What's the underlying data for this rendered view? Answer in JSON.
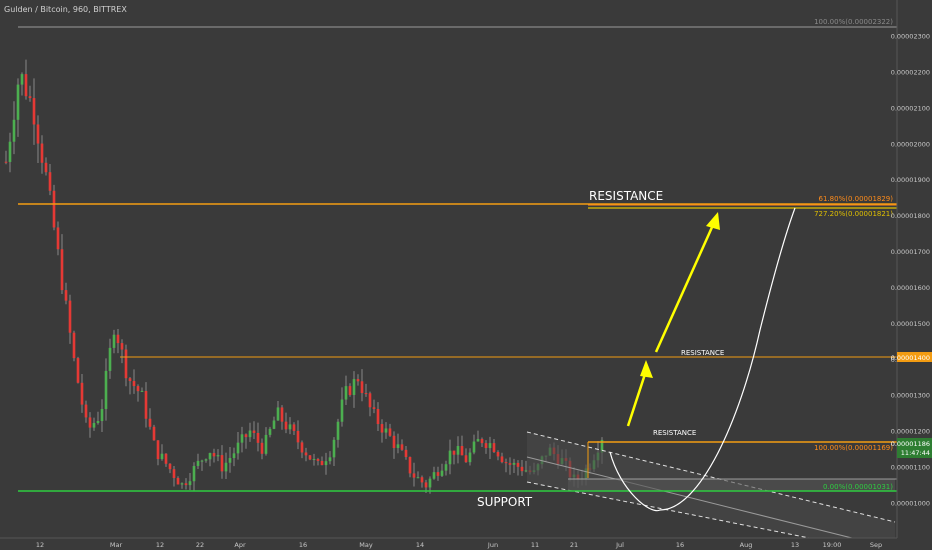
{
  "header": {
    "symbol_title": "Gulden / Bitcoin, 960, BITTREX"
  },
  "price_axis": {
    "ticks": [
      "0.00002300",
      "0.00002200",
      "0.00002100",
      "0.00002000",
      "0.00001900",
      "0.00001800",
      "0.00001700",
      "0.00001600",
      "0.00001500",
      "0.00001400",
      "0.00001300",
      "0.00001200",
      "0.00001100",
      "0.00001000"
    ],
    "current_price_label": "0.00001186",
    "countdown_label": "11:47:44",
    "level_1400_label": "0.00001400"
  },
  "time_axis": {
    "labels": [
      "12",
      "Mar",
      "12",
      "22",
      "Apr",
      "16",
      "May",
      "14",
      "Jun",
      "11",
      "21",
      "Jul",
      "16",
      "Aug",
      "13",
      "19:00",
      "Sep"
    ]
  },
  "annotations": {
    "resistance_top": "RESISTANCE",
    "resistance_mid": "RESISTANCE",
    "resistance_low": "RESISTANCE",
    "support": "SUPPORT",
    "fib_100_top": "100.00%(0.00002322)",
    "fib_61_8": "61.80%(0.00001829)",
    "fib_727_2": "727.20%(0.00001821)",
    "fib_100_low": "100.00%(0.00001169)",
    "fib_0": "0.00%(0.00001031)"
  },
  "colors": {
    "background": "#3a3a3a",
    "candle_up": "#4caf50",
    "candle_down": "#e53935",
    "support_line": "#2ecc40",
    "resistance_line": "#f39c12",
    "arrow": "#ffff00",
    "fib_text": "#ff8c1a"
  },
  "chart_data": {
    "type": "candlestick",
    "title": "Gulden / Bitcoin, 960, BITTREX",
    "ylim": [
      9.8e-06,
      2.38e-05
    ],
    "log_scale": false,
    "grid": false,
    "levels": [
      {
        "name": "RESISTANCE",
        "value": 1.829e-05
      },
      {
        "name": "RESISTANCE",
        "value": 1.4e-05
      },
      {
        "name": "RESISTANCE",
        "value": 1.169e-05
      },
      {
        "name": "SUPPORT",
        "value": 1.031e-05
      }
    ],
    "fib_levels": [
      {
        "label": "100.00%(0.00002322)",
        "value": 2.322e-05
      },
      {
        "label": "61.80%(0.00001829)",
        "value": 1.829e-05
      },
      {
        "label": "727.20%(0.00001821)",
        "value": 1.821e-05
      },
      {
        "label": "100.00%(0.00001169)",
        "value": 1.169e-05
      },
      {
        "label": "0.00%(0.00001031)",
        "value": 1.031e-05
      }
    ],
    "price_path": [
      1.95e-05,
      2.2e-05,
      2.1e-05,
      1.9e-05,
      1.65e-05,
      1.4e-05,
      1.2e-05,
      1.25e-05,
      1.5e-05,
      1.35e-05,
      1.3e-05,
      1.15e-05,
      1.1e-05,
      1.05e-05,
      1.1e-05,
      1.15e-05,
      1.1e-05,
      1.15e-05,
      1.2e-05,
      1.15e-05,
      1.25e-05,
      1.2e-05,
      1.15e-05,
      1.1e-05,
      1.15e-05,
      1.3e-05,
      1.35e-05,
      1.25e-05,
      1.2e-05,
      1.15e-05,
      1.08e-05,
      1.05e-05,
      1.1e-05,
      1.15e-05,
      1.12e-05,
      1.18e-05,
      1.16e-05,
      1.11e-05,
      1.1e-05,
      1.08e-05,
      1.15e-05,
      1.12e-05,
      1.06e-05,
      1.1e-05,
      1.186e-05
    ],
    "last_price": 1.186e-05
  }
}
